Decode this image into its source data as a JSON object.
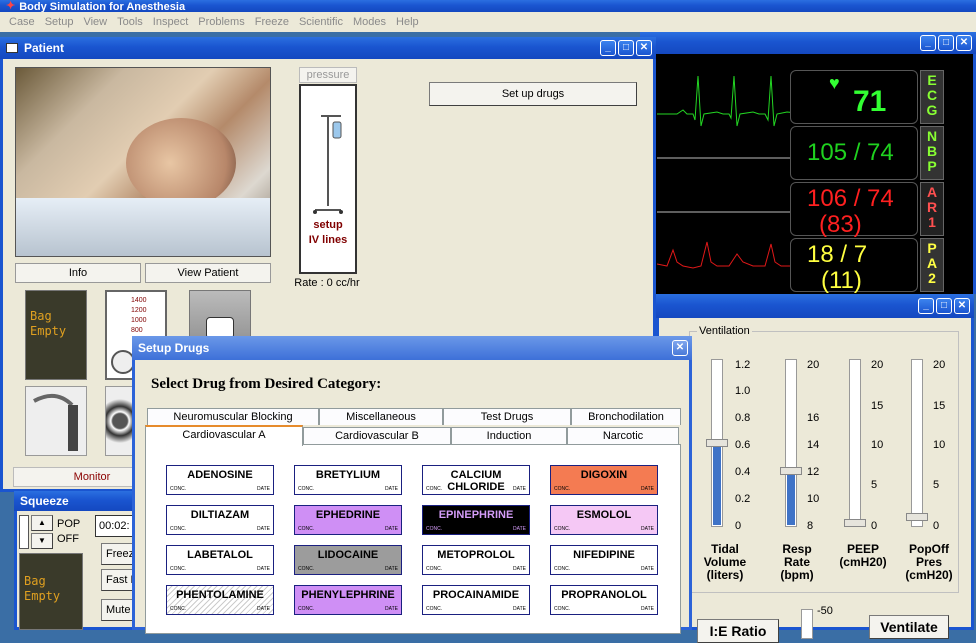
{
  "app": {
    "title": "Body Simulation for Anesthesia",
    "menu": [
      "Case",
      "Setup",
      "View",
      "Tools",
      "Inspect",
      "Problems",
      "Freeze",
      "Scientific",
      "Modes",
      "Help"
    ]
  },
  "patient": {
    "title": "Patient",
    "pressure_label": "pressure",
    "iv_label_1": "setup",
    "iv_label_2": "IV lines",
    "rate_label": "Rate : 0 cc/hr",
    "setup_drugs_button": "Set up drugs",
    "info_button": "Info",
    "view_patient_button": "View Patient",
    "bag_label_1": "Bag",
    "bag_label_2": "Empty",
    "gauge_ticks": [
      "1400",
      "1200",
      "1000",
      "800"
    ],
    "monitor_button": "Monitor"
  },
  "monitor": {
    "hr": "71",
    "nbp": "105 / 74",
    "art_1": "106 / 74",
    "art_2": "(83)",
    "pa_1": "18 / 7",
    "pa_2": "(11)",
    "labels": {
      "ecg": [
        "E",
        "C",
        "G"
      ],
      "nbp": [
        "N",
        "B",
        "P"
      ],
      "ar": [
        "A",
        "R",
        "1"
      ],
      "pa": [
        "P",
        "A",
        "2"
      ]
    },
    "colors": {
      "hr": "#32ff32",
      "nbp": "#1fd21f",
      "art": "#ff2020",
      "pa": "#ffff40"
    }
  },
  "ventilation": {
    "group_label": "Ventilation",
    "tidal_volume": {
      "ticks": [
        "1.2",
        "1.0",
        "0.8",
        "0.6",
        "0.4",
        "0.2",
        "0"
      ],
      "label_1": "Tidal",
      "label_2": "Volume",
      "label_3": "(liters)",
      "value": 0.6
    },
    "resp_rate": {
      "ticks": [
        "20",
        "16",
        "14",
        "12",
        "10",
        "8"
      ],
      "label_1": "Resp",
      "label_2": "Rate",
      "label_3": "(bpm)",
      "value": 12
    },
    "peep": {
      "ticks": [
        "20",
        "15",
        "10",
        "5",
        "0"
      ],
      "label_1": "PEEP",
      "label_2": "(cmH20)",
      "value": 0
    },
    "popoff": {
      "ticks": [
        "20",
        "15",
        "10",
        "5",
        "0"
      ],
      "label_1": "PopOff",
      "label_2": "Pres",
      "label_3": "(cmH20)",
      "value": 1
    },
    "ie_button": "I:E Ratio",
    "ventilate_button": "Ventilate",
    "scale_top": "-50"
  },
  "setup_drugs": {
    "title": "Setup Drugs",
    "heading": "Select Drug from Desired Category:",
    "tabs_back": [
      "Neuromuscular Blocking",
      "Miscellaneous",
      "Test Drugs",
      "Bronchodilation"
    ],
    "tabs_front": [
      "Cardiovascular A",
      "Cardiovascular B",
      "Induction",
      "Narcotic"
    ],
    "conc_label": "CONC.",
    "date_label": "DATE",
    "drugs": [
      {
        "name": "ADENOSINE",
        "bg": "#ffffff",
        "fg": "#000000"
      },
      {
        "name": "BRETYLIUM",
        "bg": "#ffffff",
        "fg": "#000000"
      },
      {
        "name": "CALCIUM CHLORIDE",
        "bg": "#ffffff",
        "fg": "#000000"
      },
      {
        "name": "DIGOXIN",
        "bg": "#f47b52",
        "fg": "#000000"
      },
      {
        "name": "DILTIAZAM",
        "bg": "#ffffff",
        "fg": "#000000"
      },
      {
        "name": "EPHEDRINE",
        "bg": "#cf8ff5",
        "fg": "#000000"
      },
      {
        "name": "EPINEPHRINE",
        "bg": "#000000",
        "fg": "#d49cf8"
      },
      {
        "name": "ESMOLOL",
        "bg": "#f5c8f5",
        "fg": "#000000"
      },
      {
        "name": "LABETALOL",
        "bg": "#ffffff",
        "fg": "#000000"
      },
      {
        "name": "LIDOCAINE",
        "bg": "#9c9c9c",
        "fg": "#000000"
      },
      {
        "name": "METOPROLOL",
        "bg": "#ffffff",
        "fg": "#000000"
      },
      {
        "name": "NIFEDIPINE",
        "bg": "#ffffff",
        "fg": "#000000"
      },
      {
        "name": "PHENTOLAMINE",
        "bg": "#ffffff",
        "fg": "#000000"
      },
      {
        "name": "PHENYLEPHRINE",
        "bg": "#cf8ff5",
        "fg": "#000000"
      },
      {
        "name": "PROCAINAMIDE",
        "bg": "#ffffff",
        "fg": "#000000"
      },
      {
        "name": "PROPRANOLOL",
        "bg": "#ffffff",
        "fg": "#000000"
      }
    ]
  },
  "squeeze": {
    "title": "Squeeze",
    "pop_label": "POP",
    "off_label": "OFF",
    "timer": "00:02:",
    "freeze_button": "Freez",
    "fast_button": "Fast F",
    "mute_button": "Mute",
    "bag_label_1": "Bag",
    "bag_label_2": "Empty"
  }
}
